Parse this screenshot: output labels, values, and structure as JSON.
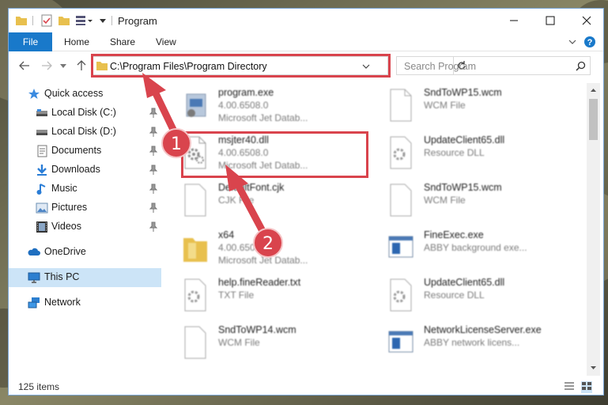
{
  "window": {
    "title": "Program",
    "minimize_icon": "minimize-icon",
    "maximize_icon": "maximize-icon",
    "close_icon": "close-icon"
  },
  "ribbon": {
    "tabs": [
      "File",
      "Home",
      "Share",
      "View"
    ],
    "accent_color": "#1979ca"
  },
  "address": {
    "path": "C:\\Program Files\\Program Directory",
    "search_placeholder": "Search Program"
  },
  "sidebar": {
    "items": [
      {
        "label": "Quick access",
        "icon": "star-icon",
        "pinned": false
      },
      {
        "label": "Local Disk (C:)",
        "icon": "drive-icon",
        "pinned": true
      },
      {
        "label": "Local Disk (D:)",
        "icon": "drive-icon",
        "pinned": true
      },
      {
        "label": "Documents",
        "icon": "documents-icon",
        "pinned": true
      },
      {
        "label": "Downloads",
        "icon": "download-icon",
        "pinned": true
      },
      {
        "label": "Music",
        "icon": "music-icon",
        "pinned": true
      },
      {
        "label": "Pictures",
        "icon": "pictures-icon",
        "pinned": true
      },
      {
        "label": "Videos",
        "icon": "videos-icon",
        "pinned": true
      },
      {
        "label": "OneDrive",
        "icon": "cloud-icon",
        "pinned": false
      },
      {
        "label": "This PC",
        "icon": "computer-icon",
        "pinned": false
      },
      {
        "label": "Network",
        "icon": "network-icon",
        "pinned": false
      }
    ]
  },
  "files": [
    {
      "name": "program.exe",
      "line2": "4.00.6508.0",
      "line3": "Microsoft Jet Datab...",
      "icon": "exe-icon"
    },
    {
      "name": "SndToWP15.wcm",
      "line2": "WCM File",
      "line3": "",
      "icon": "file-icon"
    },
    {
      "name": "msjter40.dll",
      "line2": "4.00.6508.0",
      "line3": "Microsoft Jet Datab...",
      "icon": "gear-file-icon"
    },
    {
      "name": "UpdateClient65.dll",
      "line2": "Resource DLL",
      "line3": "",
      "icon": "gear-file-icon"
    },
    {
      "name": "DefaultFont.cjk",
      "line2": "CJK File",
      "line3": "",
      "icon": "file-icon"
    },
    {
      "name": "SndToWP15.wcm",
      "line2": "WCM File",
      "line3": "",
      "icon": "file-icon"
    },
    {
      "name": "x64",
      "line2": "4.00.6508.0",
      "line3": "Microsoft Jet Datab...",
      "icon": "folder-icon"
    },
    {
      "name": "FineExec.exe",
      "line2": "ABBY background exe...",
      "line3": "",
      "icon": "app-window-icon"
    },
    {
      "name": "help.fineReader.txt",
      "line2": "TXT File",
      "line3": "",
      "icon": "gear-file-icon"
    },
    {
      "name": "UpdateClient65.dll",
      "line2": "Resource DLL",
      "line3": "",
      "icon": "gear-file-icon"
    },
    {
      "name": "SndToWP14.wcm",
      "line2": "WCM File",
      "line3": "",
      "icon": "file-icon"
    },
    {
      "name": "NetworkLicenseServer.exe",
      "line2": "ABBY network licens...",
      "line3": "",
      "icon": "app-window-icon"
    }
  ],
  "status": {
    "item_count": "125 items"
  },
  "annotations": {
    "step1": "1",
    "step2": "2",
    "color": "#d9444d"
  }
}
